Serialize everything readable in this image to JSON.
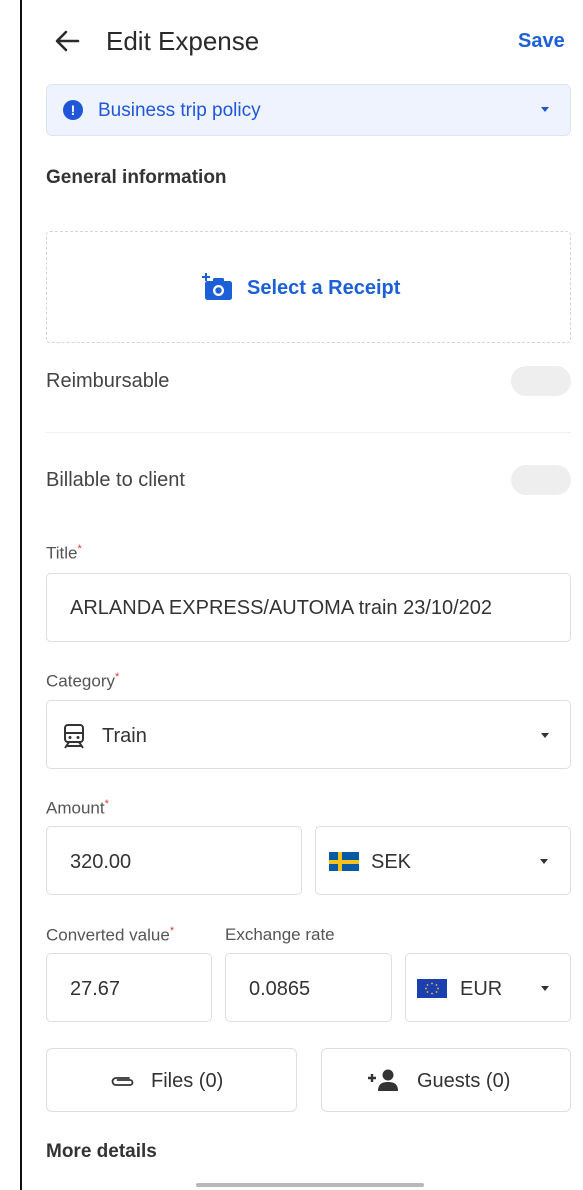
{
  "header": {
    "title": "Edit Expense",
    "save_label": "Save"
  },
  "policy": {
    "label": "Business trip policy",
    "info_glyph": "!"
  },
  "general": {
    "section_title": "General information"
  },
  "receipt": {
    "label": "Select a Receipt"
  },
  "reimbursable": {
    "label": "Reimbursable",
    "enabled": false
  },
  "billable": {
    "label": "Billable to client",
    "enabled": false
  },
  "title_field": {
    "label": "Title",
    "value": "ARLANDA EXPRESS/AUTOMA train 23/10/202"
  },
  "category": {
    "label": "Category",
    "value": "Train",
    "icon": "train-icon"
  },
  "amount": {
    "label": "Amount",
    "value": "320.00",
    "currency": "SEK"
  },
  "converted": {
    "label": "Converted value",
    "value": "27.67"
  },
  "exchange": {
    "label": "Exchange rate",
    "value": "0.0865",
    "currency": "EUR"
  },
  "required_mark": "*",
  "buttons": {
    "files": "Files (0)",
    "guests": "Guests (0)"
  },
  "more_details": "More details",
  "colors": {
    "accent": "#1d5fd6",
    "policy_bg": "#eef3fd",
    "required": "#e03b3b"
  }
}
